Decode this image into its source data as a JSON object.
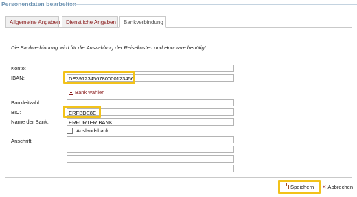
{
  "window": {
    "title": "Personendaten bearbeiten"
  },
  "tabs": [
    {
      "label": "Allgemeine Angaben",
      "active": false
    },
    {
      "label": "Dienstliche Angaben",
      "active": false
    },
    {
      "label": "Bankverbindung",
      "active": true
    }
  ],
  "form": {
    "intro": "Die Bankverbindung wird für die Auszahlung der Reisekosten und Honorare benötigt.",
    "konto": {
      "label": "Konto:",
      "value": ""
    },
    "iban": {
      "label": "IBAN:",
      "value": "DE39123456780000123456"
    },
    "bank_link": {
      "label": "Bank wählen",
      "icon": "bank-select-icon"
    },
    "bankleitzahl": {
      "label": "Bankleitzahl:",
      "value": ""
    },
    "bic": {
      "label": "BIC:",
      "value": "ERFBDE8E"
    },
    "bankname": {
      "label": "Name der Bank:",
      "value": "ERFURTER BANK"
    },
    "auslandsbank": {
      "label": "Auslandsbank",
      "checked": false
    },
    "anschrift": {
      "label": "Anschrift:",
      "lines": [
        "",
        "",
        "",
        ""
      ]
    }
  },
  "footer": {
    "save_label": "Speichern",
    "cancel_label": "Abbrechen"
  },
  "colors": {
    "accent_title": "#6f94b3",
    "link": "#8a1c1c",
    "highlight": "#f2c21a"
  }
}
